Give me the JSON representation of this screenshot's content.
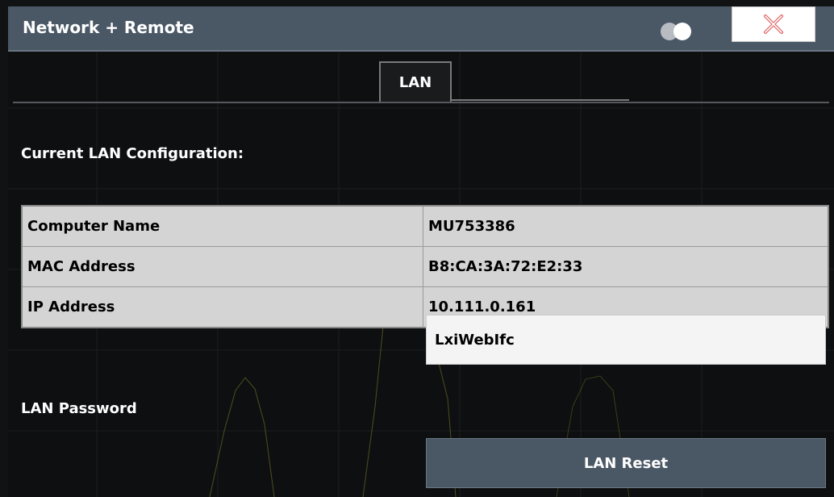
{
  "window": {
    "title": "Network + Remote",
    "toggle_icon": "display-toggle-icon",
    "close_icon": "close-x-icon"
  },
  "tabs": [
    {
      "label": "LAN",
      "active": true
    }
  ],
  "section": {
    "heading": "Current LAN Configuration:"
  },
  "lan_table": {
    "rows": [
      {
        "key": "Computer Name",
        "value": "MU753386"
      },
      {
        "key": "MAC Address",
        "value": "B8:CA:3A:72:E2:33"
      },
      {
        "key": "IP Address",
        "value": "10.111.0.161"
      }
    ]
  },
  "password": {
    "label": "LAN Password",
    "value": "LxiWebIfc"
  },
  "actions": {
    "reset_label": "LAN Reset"
  },
  "colors": {
    "titlebar": "#4a5866",
    "background": "#0e0f10",
    "close_x": "#e06060",
    "table_bg": "#d4d4d4"
  }
}
